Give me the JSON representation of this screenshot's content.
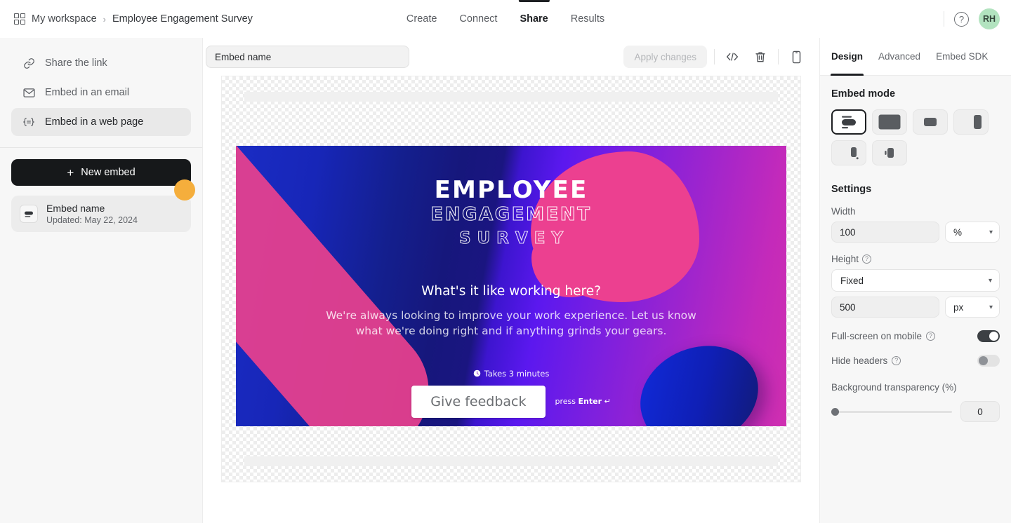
{
  "header": {
    "workspace_icon": "grid-icon",
    "workspace": "My workspace",
    "separator": "›",
    "project": "Employee Engagement Survey",
    "tabs": [
      {
        "label": "Create",
        "active": false
      },
      {
        "label": "Connect",
        "active": false
      },
      {
        "label": "Share",
        "active": true
      },
      {
        "label": "Results",
        "active": false
      }
    ],
    "help_icon": "?",
    "avatar_initials": "RH",
    "avatar_color": "#b2e3bf"
  },
  "sidebar": {
    "items": [
      {
        "label": "Share the link",
        "icon": "link-icon",
        "active": false
      },
      {
        "label": "Embed in an email",
        "icon": "envelope-icon",
        "active": false
      },
      {
        "label": "Embed in a web page",
        "icon": "code-brace-icon",
        "active": true
      }
    ],
    "new_embed_label": "New embed",
    "new_embed_plus": "+",
    "embed_card": {
      "title": "Embed name",
      "subtitle": "Updated: May 22, 2024"
    }
  },
  "toolbar": {
    "name_value": "Embed name",
    "name_placeholder": "Embed name",
    "apply_label": "Apply changes",
    "icons": [
      "code-icon",
      "trash-icon",
      "mobile-preview-icon"
    ]
  },
  "survey": {
    "title_line1": "EMPLOYEE",
    "title_line2": "ENGAGEMENT",
    "title_line3": "SURVEY",
    "question": "What's it like working here?",
    "description": "We're always looking to improve your work experience. Let us know what we're doing right and if anything grinds your gears.",
    "duration": "Takes 3 minutes",
    "cta_label": "Give feedback",
    "press_prefix": "press ",
    "press_key": "Enter",
    "press_arrow": "↵"
  },
  "right_panel": {
    "tabs": [
      {
        "label": "Design",
        "active": true
      },
      {
        "label": "Advanced",
        "active": false
      },
      {
        "label": "Embed SDK",
        "active": false
      }
    ],
    "embed_mode_heading": "Embed mode",
    "embed_modes": [
      {
        "name": "standard-inline",
        "selected": true
      },
      {
        "name": "full-page",
        "selected": false
      },
      {
        "name": "popup",
        "selected": false
      },
      {
        "name": "slider-right",
        "selected": false
      },
      {
        "name": "popover-bottom-right",
        "selected": false
      },
      {
        "name": "side-tab",
        "selected": false
      }
    ],
    "settings_heading": "Settings",
    "width_label": "Width",
    "width_value": "100",
    "width_unit": "%",
    "height_label": "Height",
    "height_mode": "Fixed",
    "height_value": "500",
    "height_unit": "px",
    "fullscreen_label": "Full-screen on mobile",
    "fullscreen_on": true,
    "hide_headers_label": "Hide headers",
    "hide_headers_on": false,
    "transparency_label": "Background transparency (%)",
    "transparency_value": "0",
    "help_glyph": "?"
  }
}
